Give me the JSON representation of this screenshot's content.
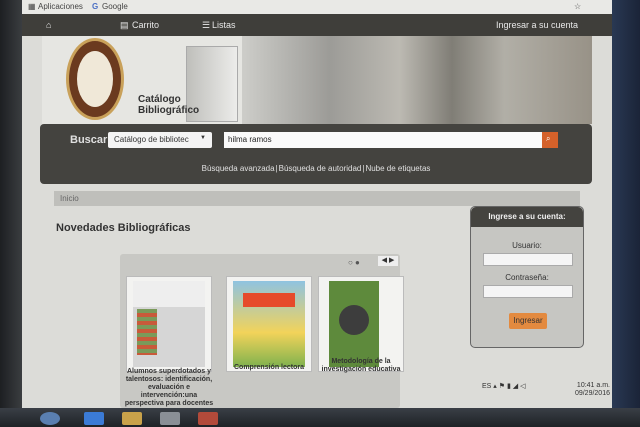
{
  "browser": {
    "bookmarks": [
      "Aplicaciones",
      "Google"
    ]
  },
  "nav": {
    "home_icon": "home-icon",
    "cart_label": "Carrito",
    "lists_label": "Listas",
    "login_link": "Ingresar a su cuenta"
  },
  "header": {
    "catalog_title_line1": "Catálogo",
    "catalog_title_line2": "Bibliográfico"
  },
  "search": {
    "label": "Buscar",
    "scope_value": "Catálogo de bibliotec",
    "query": "hilma ramos",
    "links": [
      "Búsqueda avanzada",
      "Búsqueda de autoridad",
      "Nube de etiquetas"
    ]
  },
  "breadcrumb": "Inicio",
  "news": {
    "title": "Novedades Bibliográficas",
    "items": [
      {
        "title": "Alumnos superdotados y talentosos: identificación, evaluación e intervención:una perspectiva para docentes"
      },
      {
        "title": "Comprensión lectora"
      },
      {
        "title": "Metodología de la investigación educativa"
      }
    ]
  },
  "login": {
    "heading": "Ingrese a su cuenta:",
    "user_label": "Usuario:",
    "password_label": "Contraseña:",
    "button": "Ingresar"
  },
  "taskbar": {
    "time": "10:41 a.m.",
    "date": "09/29/2016"
  },
  "colors": {
    "dark_bar": "#44433f",
    "accent_orange": "#d4612a",
    "button_orange": "#e38a3f"
  }
}
